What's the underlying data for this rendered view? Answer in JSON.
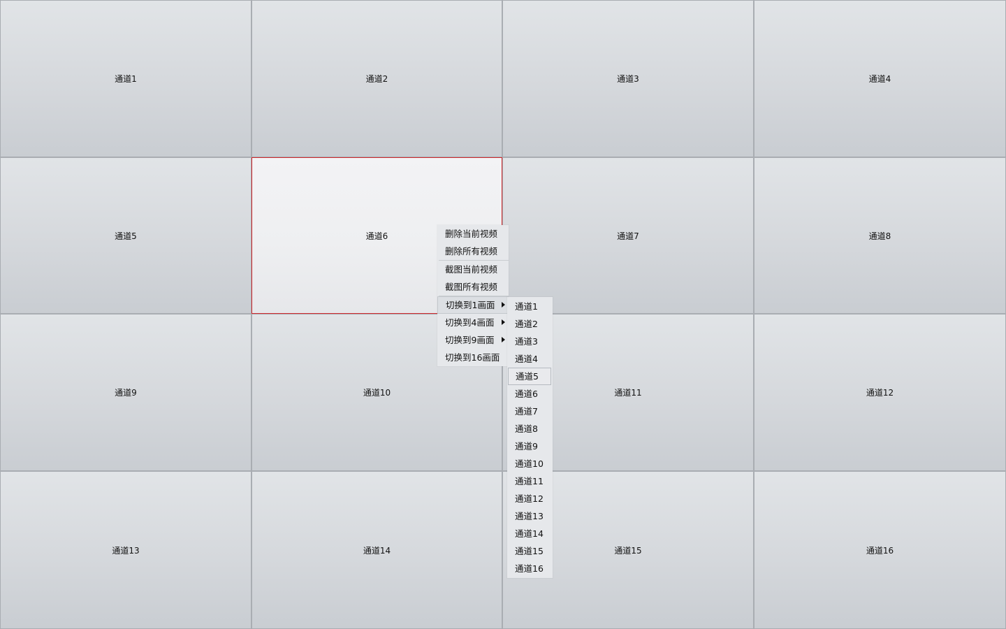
{
  "cells": [
    {
      "label": "通道1"
    },
    {
      "label": "通道2"
    },
    {
      "label": "通道3"
    },
    {
      "label": "通道4"
    },
    {
      "label": "通道5"
    },
    {
      "label": "通道6",
      "selected": true
    },
    {
      "label": "通道7"
    },
    {
      "label": "通道8"
    },
    {
      "label": "通道9"
    },
    {
      "label": "通道10"
    },
    {
      "label": "通道11"
    },
    {
      "label": "通道12"
    },
    {
      "label": "通道13"
    },
    {
      "label": "通道14"
    },
    {
      "label": "通道15"
    },
    {
      "label": "通道16"
    }
  ],
  "context_menu": {
    "delete_current": "删除当前视频",
    "delete_all": "删除所有视频",
    "snapshot_current": "截图当前视频",
    "snapshot_all": "截图所有视频",
    "switch_1": "切换到1画面",
    "switch_4": "切换到4画面",
    "switch_9": "切换到9画面",
    "switch_16": "切换到16画面"
  },
  "submenu": {
    "items": [
      "通道1",
      "通道2",
      "通道3",
      "通道4",
      "通道5",
      "通道6",
      "通道7",
      "通道8",
      "通道9",
      "通道10",
      "通道11",
      "通道12",
      "通道13",
      "通道14",
      "通道15",
      "通道16"
    ],
    "hovered_index": 4
  },
  "colors": {
    "selected_border": "#d0282c",
    "cell_border": "#a9adb2",
    "menu_bg": "#e6e8eb"
  },
  "icons": {
    "submenu_arrow": "triangle-right-icon"
  }
}
